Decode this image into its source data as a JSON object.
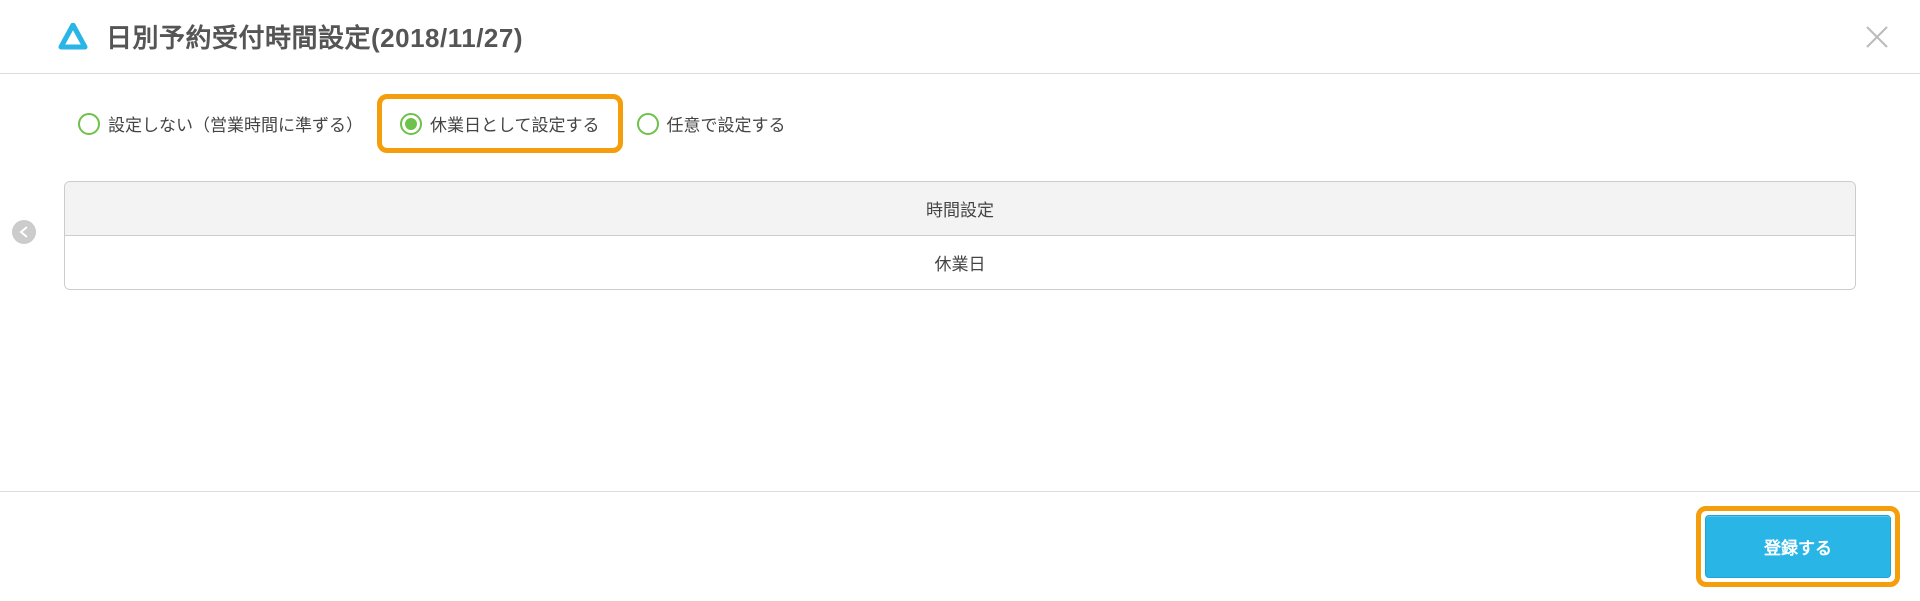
{
  "header": {
    "title": "日別予約受付時間設定(2018/11/27)"
  },
  "options": {
    "opt1": {
      "label": "設定しない（営業時間に準ずる）",
      "selected": false
    },
    "opt2": {
      "label": "休業日として設定する",
      "selected": true,
      "highlighted": true
    },
    "opt3": {
      "label": "任意で設定する",
      "selected": false
    }
  },
  "panel": {
    "header": "時間設定",
    "body": "休業日"
  },
  "footer": {
    "submit_label": "登録する"
  },
  "colors": {
    "accent_green": "#6cc24a",
    "highlight_orange": "#f59e0b",
    "primary_blue": "#29b6e6"
  }
}
